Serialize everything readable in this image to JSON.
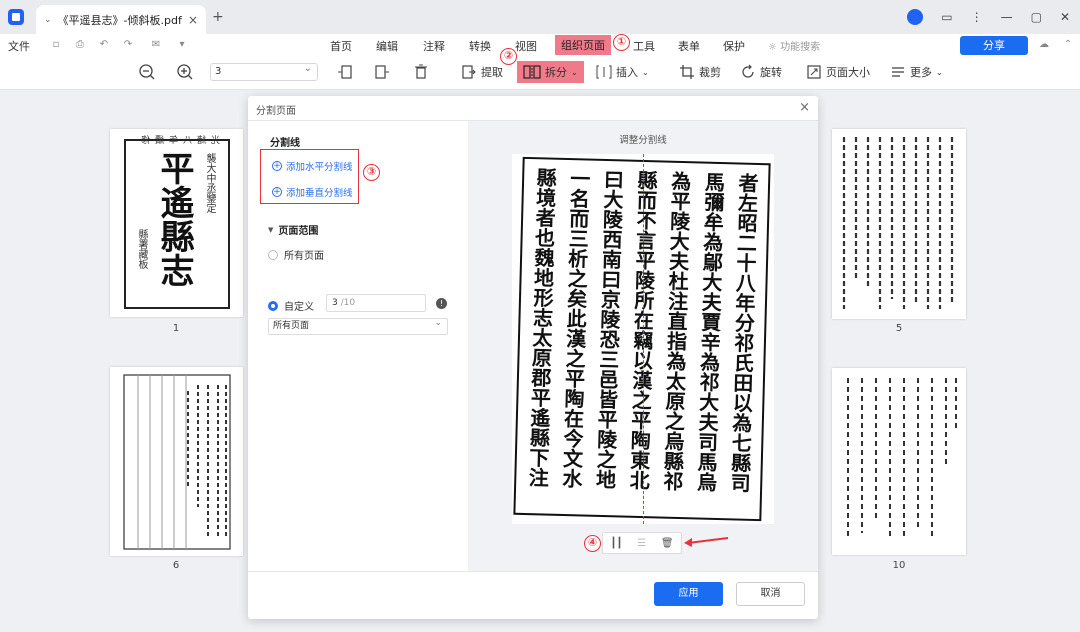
{
  "titlebar": {
    "doc_tab_title": "《平遥县志》-倾斜板.pdf"
  },
  "menubar": {
    "file": "文件",
    "items": [
      "首页",
      "编辑",
      "注释",
      "转换",
      "视图",
      "组织页面",
      "工具",
      "表单",
      "保护"
    ],
    "search_placeholder": "功能搜索",
    "share": "分享"
  },
  "toolbar": {
    "zoom_value": "3",
    "extract": "提取",
    "split": "拆分",
    "insert": "插入",
    "crop": "裁剪",
    "rotate": "旋转",
    "page_size": "页面大小",
    "more": "更多"
  },
  "pages": [
    {
      "num": "1"
    },
    {
      "num": "5"
    },
    {
      "num": "6"
    },
    {
      "num": "10"
    }
  ],
  "dialog": {
    "title": "分割页面",
    "section_split_lines": "分割线",
    "add_horizontal": "添加水平分割线",
    "add_vertical": "添加垂直分割线",
    "section_range": "页面范围",
    "all_pages": "所有页面",
    "custom": "自定义",
    "custom_value": "3",
    "custom_total": "/10",
    "scope_select": "所有页面",
    "adjust_label": "调整分割线",
    "apply": "应用",
    "cancel": "取消"
  },
  "preview_text": {
    "cols": [
      "者左昭二十八年分祁氏田以為七縣司",
      "馬彌牟為鄔大夫賈辛為祁大夫司馬烏",
      "為平陵大夫杜注直指為太原之烏縣祁",
      "縣而不言平陵所在竊以漢之平陶東北",
      "曰大陵西南曰京陵恐三邑皆平陵之地",
      "一名而三析之矣此漢之平陶在今文水",
      "縣境者也魏地形志太原郡平遙縣下注"
    ]
  },
  "thumb1_text": {
    "top_line": "光緒八年續修",
    "title": "平遙縣志",
    "side": "縣署藏板",
    "small": "襲大中丞鑒定"
  },
  "steps": [
    "①",
    "②",
    "③",
    "④"
  ],
  "colors": {
    "accent": "#1a6cf0",
    "highlight": "#f07a8a",
    "annotation": "#e8323c"
  }
}
